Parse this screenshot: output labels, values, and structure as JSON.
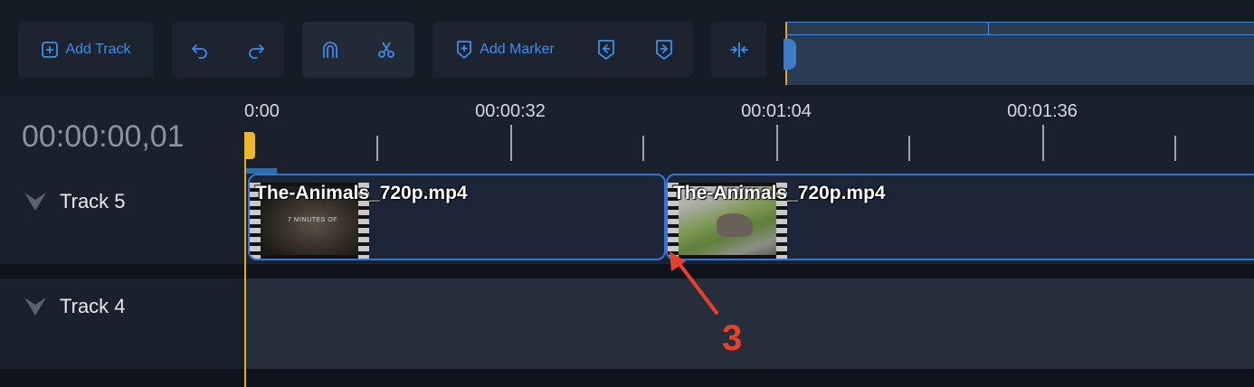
{
  "toolbar": {
    "add_track_label": "Add Track",
    "add_marker_label": "Add Marker",
    "icons": [
      "plus-square-icon",
      "undo-icon",
      "redo-icon",
      "magnet-icon",
      "scissors-icon",
      "marker-plus-icon",
      "prev-marker-icon",
      "next-marker-icon",
      "collapse-icon"
    ]
  },
  "timeline": {
    "timecode": "00:00:00,01",
    "ruler_labels": [
      "0:00",
      "00:00:32",
      "00:01:04",
      "00:01:36"
    ]
  },
  "tracks": [
    {
      "name": "Track 5",
      "clips": [
        {
          "name": "The-Animals_720p.mp4",
          "thumb_text": "7 MINUTES OF"
        },
        {
          "name": "The-Animals_720p.mp4"
        }
      ]
    },
    {
      "name": "Track 4",
      "clips": []
    }
  ],
  "annotation": {
    "label": "3",
    "color": "#e8402b"
  },
  "colors": {
    "accent": "#3e8ce8",
    "playhead": "#e8a823",
    "clip_border": "#3577d8"
  }
}
